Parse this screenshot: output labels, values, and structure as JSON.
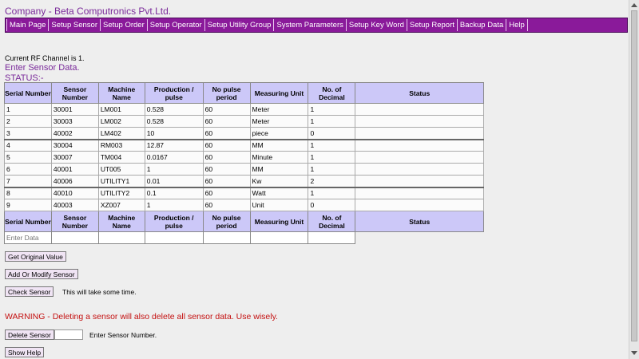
{
  "header": {
    "company": "Company - Beta Computronics Pvt.Ltd."
  },
  "nav": [
    "Main Page",
    "Setup Sensor",
    "Setup Order",
    "Setup Operator",
    "Setup Utility Group",
    "System Parameters",
    "Setup Key Word",
    "Setup Report",
    "Backup Data",
    "Help"
  ],
  "info": {
    "rf_channel": "Current RF Channel is 1.",
    "title": "Enter Sensor Data.",
    "status": "STATUS:-"
  },
  "table": {
    "columns": [
      "Serial Number",
      "Sensor Number",
      "Machine Name",
      "Production / pulse",
      "No pulse period",
      "Measuring Unit",
      "No. of Decimal",
      "Status"
    ],
    "rows": [
      [
        "1",
        "30001",
        "LM001",
        "0.528",
        "60",
        "Meter",
        "1",
        ""
      ],
      [
        "2",
        "30003",
        "LM002",
        "0.528",
        "60",
        "Meter",
        "1",
        ""
      ],
      [
        "3",
        "40002",
        "LM402",
        "10",
        "60",
        "piece",
        "0",
        ""
      ],
      [
        "4",
        "30004",
        "RM003",
        "12.87",
        "60",
        "MM",
        "1",
        ""
      ],
      [
        "5",
        "30007",
        "TM004",
        "0.0167",
        "60",
        "Minute",
        "1",
        ""
      ],
      [
        "6",
        "40001",
        "UT005",
        "1",
        "60",
        "MM",
        "1",
        ""
      ],
      [
        "7",
        "40006",
        "UTILITY1",
        "0.01",
        "60",
        "Kw",
        "2",
        ""
      ],
      [
        "8",
        "40010",
        "UTILITY2",
        "0.1",
        "60",
        "Watt",
        "1",
        ""
      ],
      [
        "9",
        "40003",
        "XZ007",
        "1",
        "60",
        "Unit",
        "0",
        ""
      ]
    ],
    "entry_placeholder": "Enter Data"
  },
  "buttons": {
    "get_original": "Get Original Value",
    "add_modify": "Add Or Modify Sensor",
    "check_sensor": "Check Sensor",
    "check_note": "This will take some time.",
    "delete_sensor": "Delete Sensor",
    "delete_note": "Enter Sensor Number.",
    "show_help": "Show Help"
  },
  "warning": "WARNING - Deleting a sensor will also delete all sensor data. Use wisely.",
  "colors": {
    "accent": "#8a1a9a",
    "header_bg": "#ccc8f8",
    "warning": "#c41010"
  }
}
